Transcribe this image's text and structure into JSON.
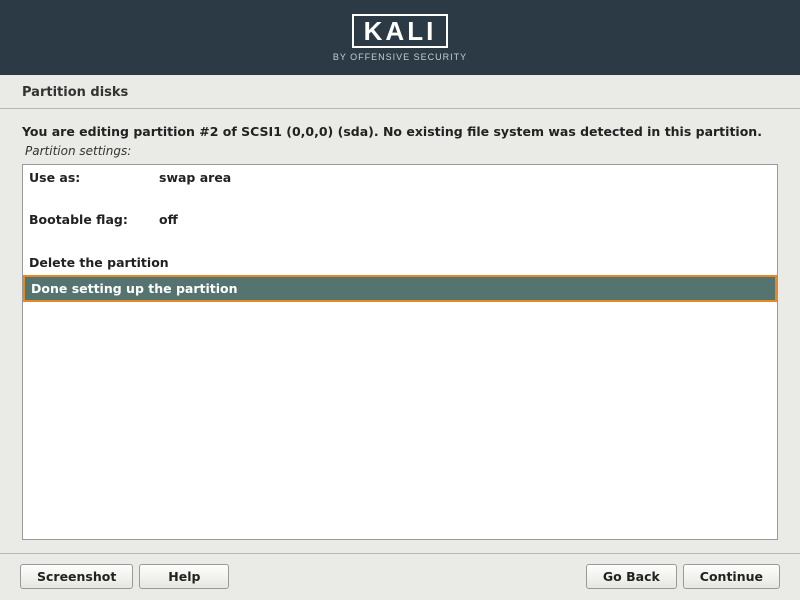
{
  "logo": {
    "title": "KALI",
    "subtitle": "BY OFFENSIVE SECURITY"
  },
  "page_title": "Partition disks",
  "description": "You are editing partition #2 of SCSI1 (0,0,0) (sda). No existing file system was detected in this partition.",
  "subheading": "Partition settings:",
  "settings": {
    "use_as": {
      "label": "Use as:",
      "value": "swap area"
    },
    "bootable": {
      "label": "Bootable flag:",
      "value": "off"
    }
  },
  "actions": {
    "delete": "Delete the partition",
    "done": "Done setting up the partition"
  },
  "buttons": {
    "screenshot": "Screenshot",
    "help": "Help",
    "go_back": "Go Back",
    "continue": "Continue"
  }
}
